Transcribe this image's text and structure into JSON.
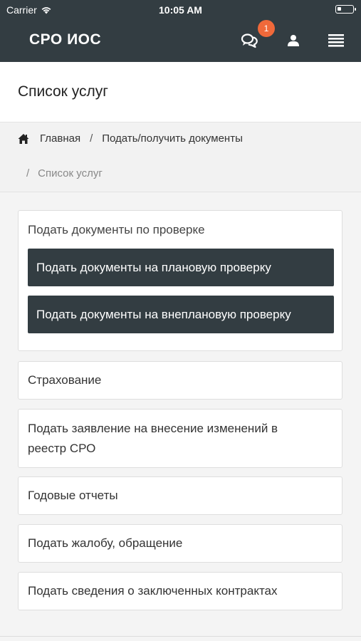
{
  "status_bar": {
    "carrier": "Carrier",
    "time": "10:05 AM"
  },
  "navbar": {
    "brand": "СРО ИОС",
    "chat_badge": "1"
  },
  "page": {
    "title": "Список услуг"
  },
  "breadcrumb": {
    "home": "Главная",
    "parent": "Подать/получить документы",
    "current": "Список услуг",
    "separator": "/"
  },
  "services": {
    "group_title": "Подать документы по проверке",
    "group_buttons": [
      "Подать документы на плановую проверку",
      "Подать документы на внеплановую проверку"
    ],
    "items": [
      "Страхование",
      "Подать заявление на внесение изменений в реестр СРО",
      "Годовые отчеты",
      "Подать жалобу, обращение",
      "Подать сведения о заключенных контрактах"
    ]
  },
  "colors": {
    "navbar_bg": "#333d42",
    "badge": "#f0693a",
    "button_bg": "#333d42"
  }
}
